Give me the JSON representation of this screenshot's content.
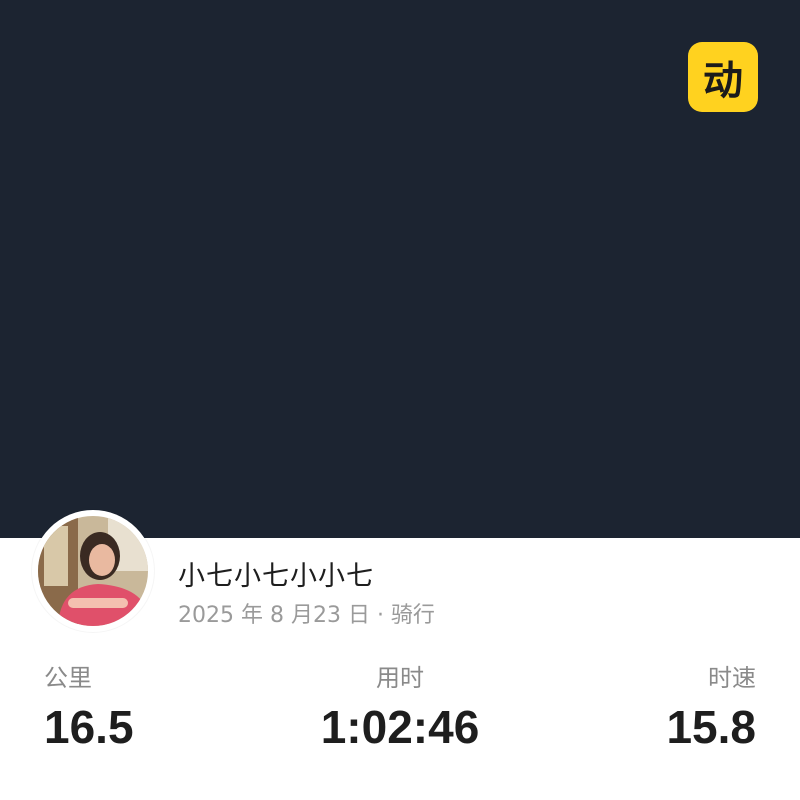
{
  "app": {
    "logo_glyph": "动",
    "logo_color": "#ffd21f"
  },
  "map": {
    "background_color": "#1c2431"
  },
  "user": {
    "avatar_icon": "user-avatar-photo",
    "name": "小七小七小小七"
  },
  "activity": {
    "meta": "2025 年 8 月23 日 · 骑行"
  },
  "stats": [
    {
      "label": "公里",
      "value": "16.5"
    },
    {
      "label": "用时",
      "value": "1:02:46"
    },
    {
      "label": "时速",
      "value": "15.8"
    }
  ]
}
